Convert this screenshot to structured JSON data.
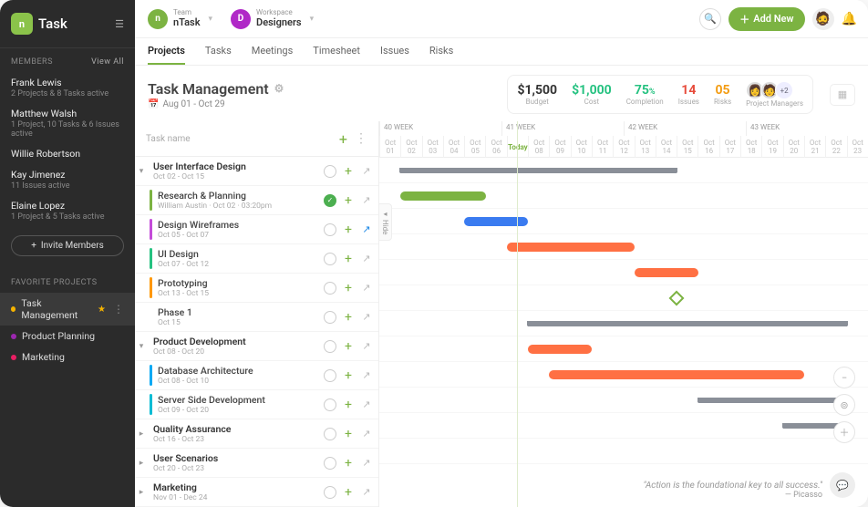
{
  "app": {
    "name": "Task",
    "logo_letter": "n"
  },
  "sidebar": {
    "members_label": "MEMBERS",
    "view_all": "View All",
    "members": [
      {
        "name": "Frank Lewis",
        "sub": "2 Projects & 8 Tasks active"
      },
      {
        "name": "Matthew Walsh",
        "sub": "1 Project, 10 Tasks & 6 Issues active"
      },
      {
        "name": "Willie Robertson",
        "sub": ""
      },
      {
        "name": "Kay Jimenez",
        "sub": "11 Issues active"
      },
      {
        "name": "Elaine Lopez",
        "sub": "1 Project & 5 Tasks active"
      }
    ],
    "invite_label": "Invite Members",
    "fav_label": "FAVORITE PROJECTS",
    "projects": [
      {
        "name": "Task Management",
        "color": "#f5b300",
        "active": true
      },
      {
        "name": "Product Planning",
        "color": "#9c27b0",
        "active": false
      },
      {
        "name": "Marketing",
        "color": "#e91e63",
        "active": false
      }
    ]
  },
  "header": {
    "team_label": "Team",
    "team_value": "nTask",
    "team_color": "#7cb342",
    "team_letter": "n",
    "workspace_label": "Workspace",
    "workspace_value": "Designers",
    "workspace_color": "#b028c7",
    "workspace_letter": "D",
    "add_new": "Add New"
  },
  "tabs": [
    "Projects",
    "Tasks",
    "Meetings",
    "Timesheet",
    "Issues",
    "Risks"
  ],
  "active_tab": "Projects",
  "project": {
    "title": "Task Management",
    "date_range": "Aug 01 - Oct 29",
    "stats": {
      "budget": {
        "value": "$1,500",
        "label": "Budget",
        "color": "#333"
      },
      "cost": {
        "value": "$1,000",
        "label": "Cost",
        "color": "#26c281"
      },
      "completion": {
        "value": "75",
        "suffix": "%",
        "label": "Completion",
        "color": "#26c281"
      },
      "issues": {
        "value": "14",
        "label": "Issues",
        "color": "#e74c3c"
      },
      "risks": {
        "value": "05",
        "label": "Risks",
        "color": "#f39c12"
      }
    },
    "pm_label": "Project Managers",
    "pm_extra": "+2"
  },
  "task_list": {
    "head_label": "Task name",
    "hide_label": "Hide",
    "rows": [
      {
        "type": "parent",
        "name": "User Interface Design",
        "sub": "Oct 02 - Oct 15",
        "stripe": "#999"
      },
      {
        "type": "child",
        "name": "Research & Planning",
        "sub": "William Austin · Oct 02 · 03:20pm",
        "stripe": "#7cb342",
        "done": true
      },
      {
        "type": "child",
        "name": "Design Wireframes",
        "sub": "Oct 05 - Oct 07",
        "stripe": "#c44cd9",
        "ext_blue": true
      },
      {
        "type": "child",
        "name": "UI Design",
        "sub": "Oct 07 - Oct 12",
        "stripe": "#26c281"
      },
      {
        "type": "child",
        "name": "Prototyping",
        "sub": "Oct 13 - Oct 15",
        "stripe": "#ff9800"
      },
      {
        "type": "child",
        "name": "Phase 1",
        "sub": "Oct 15",
        "stripe": "",
        "milestone": true
      },
      {
        "type": "parent",
        "name": "Product Development",
        "sub": "Oct 08 - Oct 20",
        "stripe": "#999"
      },
      {
        "type": "child",
        "name": "Database Architecture",
        "sub": "Oct 08 - Oct 10",
        "stripe": "#03a9f4"
      },
      {
        "type": "child",
        "name": "Server Side Development",
        "sub": "Oct 09 - Oct 20",
        "stripe": "#00bcd4"
      },
      {
        "type": "parent2",
        "name": "Quality Assurance",
        "sub": "Oct 16 - Oct 23"
      },
      {
        "type": "parent2",
        "name": "User Scenarios",
        "sub": "Oct 20 - Oct 23"
      },
      {
        "type": "parent2",
        "name": "Marketing",
        "sub": "Nov 01 - Dec 24"
      }
    ]
  },
  "timeline": {
    "weeks": [
      "40 WEEK",
      "41 WEEK",
      "42 WEEK",
      "43 WEEK"
    ],
    "today_label": "Today",
    "days": [
      "Oct 01",
      "Oct 02",
      "Oct 03",
      "Oct 04",
      "Oct 05",
      "Oct 06",
      "Oct 07",
      "Oct 08",
      "Oct 09",
      "Oct 10",
      "Oct 11",
      "Oct 12",
      "Oct 13",
      "Oct 14",
      "Oct 15",
      "Oct 16",
      "Oct 17",
      "Oct 18",
      "Oct 19",
      "Oct 20",
      "Oct 21",
      "Oct 22",
      "Oct 23"
    ],
    "today_index": 6,
    "bars": [
      {
        "row": 0,
        "type": "summary",
        "start": 1,
        "end": 14
      },
      {
        "row": 1,
        "color": "#7cb342",
        "start": 1,
        "end": 5
      },
      {
        "row": 2,
        "color": "#3a7bf0",
        "start": 4,
        "end": 7
      },
      {
        "row": 3,
        "color": "#ff7043",
        "start": 6,
        "end": 12
      },
      {
        "row": 4,
        "color": "#ff7043",
        "start": 12,
        "end": 15
      },
      {
        "row": 5,
        "type": "diamond",
        "start": 14
      },
      {
        "row": 6,
        "type": "summary",
        "start": 7,
        "end": 22
      },
      {
        "row": 7,
        "color": "#ff7043",
        "start": 7,
        "end": 10
      },
      {
        "row": 8,
        "color": "#ff7043",
        "start": 8,
        "end": 20
      },
      {
        "row": 9,
        "type": "summary",
        "start": 15,
        "end": 22
      },
      {
        "row": 10,
        "type": "summary",
        "start": 19,
        "end": 22
      }
    ]
  },
  "quote": {
    "text": "\"Action is the foundational key to all success.\"",
    "attr": "— Picasso"
  }
}
